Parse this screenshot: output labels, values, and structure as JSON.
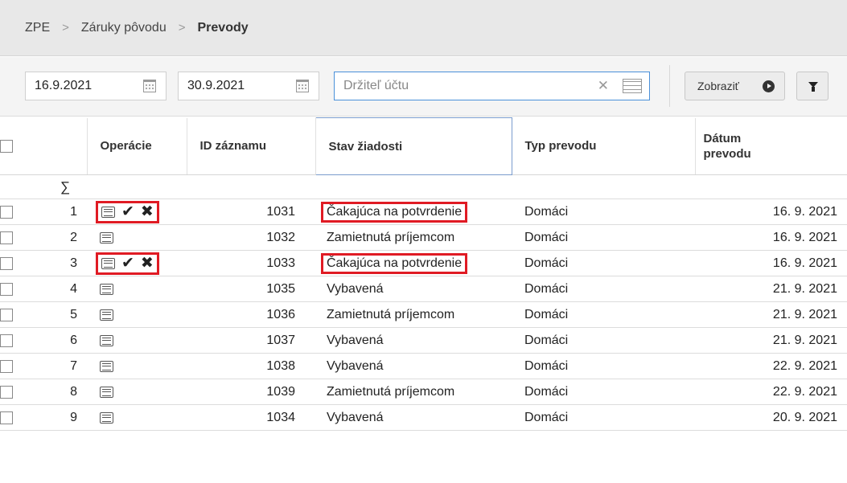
{
  "breadcrumb": {
    "root": "ZPE",
    "section": "Záruky pôvodu",
    "current": "Prevody",
    "separator": ">"
  },
  "filters": {
    "date_from": "16.9.2021",
    "date_to": "30.9.2021",
    "holder_placeholder": "Držiteľ účtu",
    "holder_value": "",
    "show_label": "Zobraziť"
  },
  "table": {
    "columns": {
      "operations": "Operácie",
      "record_id": "ID záznamu",
      "status": "Stav žiadosti",
      "transfer_type": "Typ prevodu",
      "transfer_date": "Dátum prevodu"
    },
    "sum_symbol": "∑",
    "rows": [
      {
        "num": "1",
        "id": "1031",
        "status": "Čakajúca na potvrdenie",
        "type": "Domáci",
        "date": "16. 9. 2021",
        "actions": true
      },
      {
        "num": "2",
        "id": "1032",
        "status": "Zamietnutá príjemcom",
        "type": "Domáci",
        "date": "16. 9. 2021",
        "actions": false
      },
      {
        "num": "3",
        "id": "1033",
        "status": "Čakajúca na potvrdenie",
        "type": "Domáci",
        "date": "16. 9. 2021",
        "actions": true
      },
      {
        "num": "4",
        "id": "1035",
        "status": "Vybavená",
        "type": "Domáci",
        "date": "21. 9. 2021",
        "actions": false
      },
      {
        "num": "5",
        "id": "1036",
        "status": "Zamietnutá príjemcom",
        "type": "Domáci",
        "date": "21. 9. 2021",
        "actions": false
      },
      {
        "num": "6",
        "id": "1037",
        "status": "Vybavená",
        "type": "Domáci",
        "date": "21. 9. 2021",
        "actions": false
      },
      {
        "num": "7",
        "id": "1038",
        "status": "Vybavená",
        "type": "Domáci",
        "date": "22. 9. 2021",
        "actions": false
      },
      {
        "num": "8",
        "id": "1039",
        "status": "Zamietnutá príjemcom",
        "type": "Domáci",
        "date": "22. 9. 2021",
        "actions": false
      },
      {
        "num": "9",
        "id": "1034",
        "status": "Vybavená",
        "type": "Domáci",
        "date": "20. 9. 2021",
        "actions": false
      }
    ]
  },
  "colors": {
    "highlight": "#e01b24",
    "header_bg": "#e8e8e8",
    "filter_bg": "#f4f4f4",
    "focus_border": "#4a90d9"
  },
  "icons": {
    "calendar": "calendar-icon",
    "clear": "clear-icon",
    "list": "list-icon",
    "show": "arrow-circle-right-icon",
    "filter": "funnel-icon",
    "detail": "detail-icon",
    "approve": "checkmark-icon",
    "reject": "x-icon"
  }
}
